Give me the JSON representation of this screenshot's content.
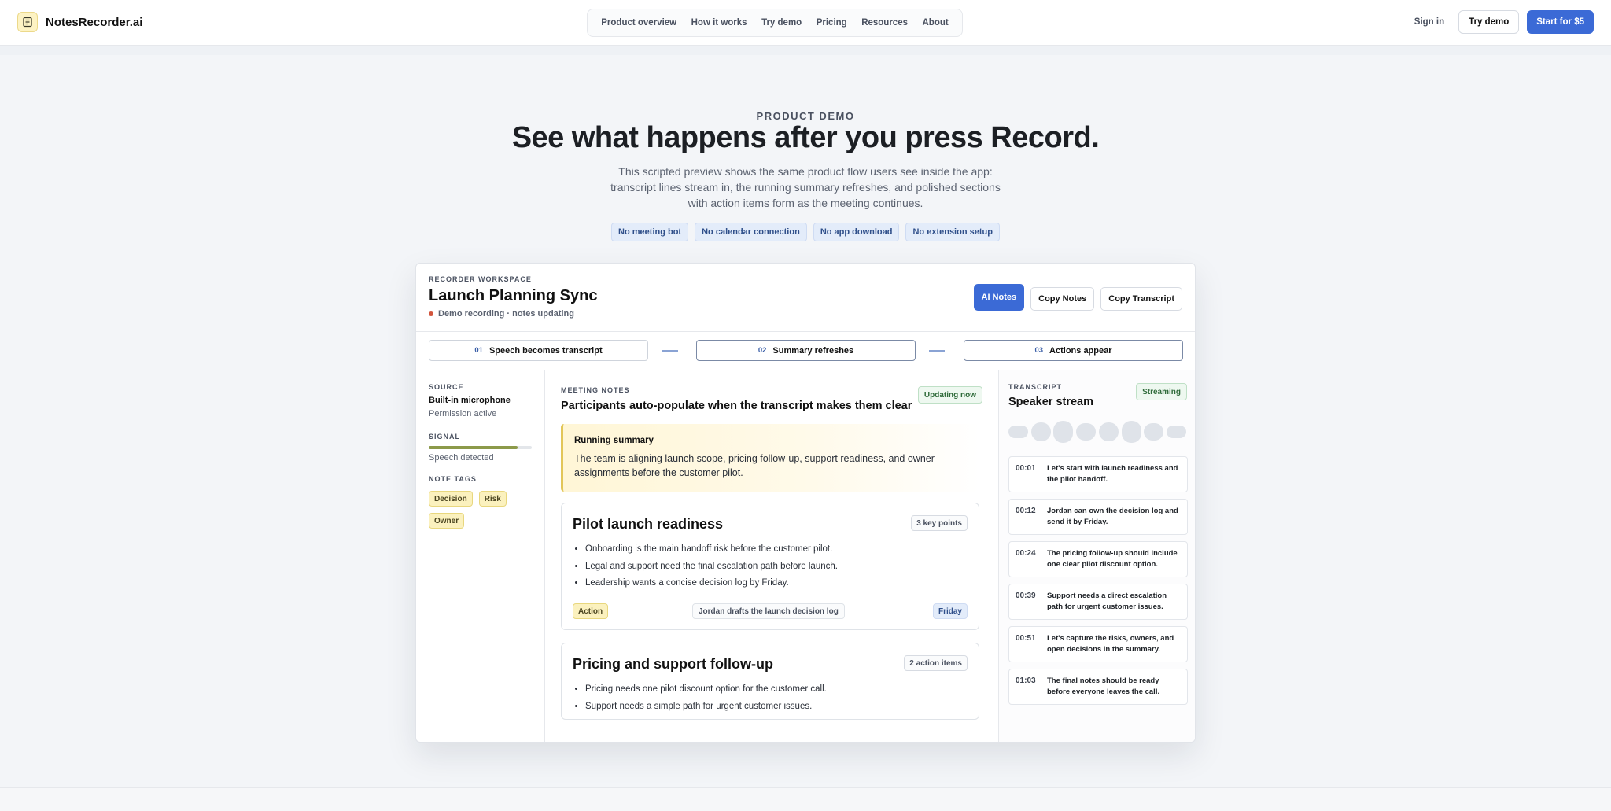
{
  "nav": {
    "brand": "NotesRecorder.ai",
    "menu": [
      "Product overview",
      "How it works",
      "Try demo",
      "Pricing",
      "Resources",
      "About"
    ],
    "sign_in": "Sign in",
    "try_demo": "Try demo",
    "start": "Start for $5"
  },
  "hero": {
    "eyebrow": "PRODUCT DEMO",
    "title": "See what happens after you press Record.",
    "subtitle": "This scripted preview shows the same product flow users see inside the app: transcript lines stream in, the running summary refreshes, and polished sections with action items form as the meeting continues.",
    "pills": [
      "No meeting bot",
      "No calendar connection",
      "No app download",
      "No extension setup"
    ]
  },
  "workspace": {
    "eyebrow": "RECORDER WORKSPACE",
    "title": "Launch Planning Sync",
    "status": "Demo recording · notes updating",
    "btn_ai": "AI Notes",
    "btn_copy_notes": "Copy Notes",
    "btn_copy_transcript": "Copy Transcript",
    "steps": [
      {
        "num": "01",
        "label": "Speech becomes transcript"
      },
      {
        "num": "02",
        "label": "Summary refreshes"
      },
      {
        "num": "03",
        "label": "Actions appear"
      }
    ]
  },
  "left": {
    "source_label": "SOURCE",
    "source_value": "Built-in microphone",
    "source_sub": "Permission active",
    "signal_label": "SIGNAL",
    "signal_level": 0.86,
    "signal_sub": "Speech detected",
    "tags_label": "NOTE TAGS",
    "tags": [
      "Decision",
      "Risk",
      "Owner"
    ]
  },
  "notes": {
    "eyebrow": "MEETING NOTES",
    "title": "Participants auto-populate when the transcript makes them clear",
    "badge": "Updating now",
    "summary_title": "Running summary",
    "summary_text": "The team is aligning launch scope, pricing follow-up, support readiness, and owner assignments before the customer pilot.",
    "sections": [
      {
        "title": "Pilot launch readiness",
        "badge": "3 key points",
        "bullets": [
          "Onboarding is the main handoff risk before the customer pilot.",
          "Legal and support need the final escalation path before launch.",
          "Leadership wants a concise decision log by Friday."
        ],
        "action_tag": "Action",
        "action_text": "Jordan drafts the launch decision log",
        "action_due": "Friday"
      },
      {
        "title": "Pricing and support follow-up",
        "badge": "2 action items",
        "bullets": [
          "Pricing needs one pilot discount option for the customer call.",
          "Support needs a simple path for urgent customer issues."
        ]
      }
    ]
  },
  "transcript": {
    "eyebrow": "TRANSCRIPT",
    "title": "Speaker stream",
    "badge": "Streaming",
    "lines": [
      {
        "time": "00:01",
        "text": "Let's start with launch readiness and the pilot handoff."
      },
      {
        "time": "00:12",
        "text": "Jordan can own the decision log and send it by Friday."
      },
      {
        "time": "00:24",
        "text": "The pricing follow-up should include one clear pilot discount option."
      },
      {
        "time": "00:39",
        "text": "Support needs a direct escalation path for urgent customer issues."
      },
      {
        "time": "00:51",
        "text": "Let's capture the risks, owners, and open decisions in the summary."
      },
      {
        "time": "01:03",
        "text": "The final notes should be ready before everyone leaves the call."
      }
    ]
  }
}
